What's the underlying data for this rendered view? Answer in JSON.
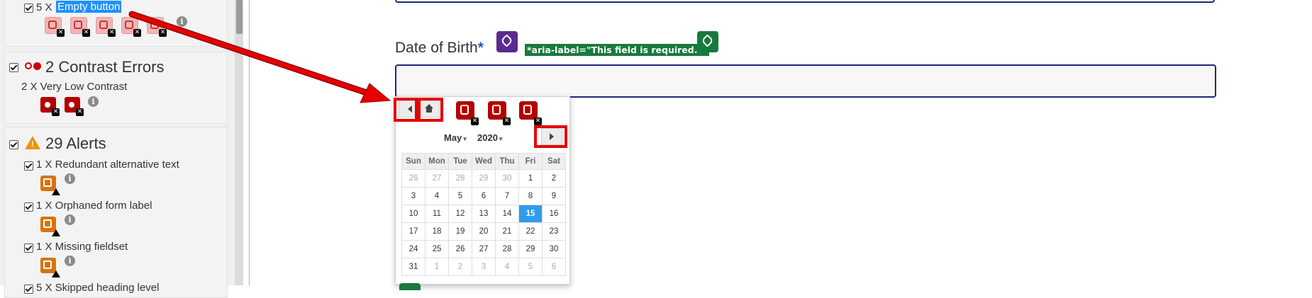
{
  "sidebar": {
    "empty_button": {
      "count": "5 X",
      "label": "Empty button",
      "icon": "empty-button-error-icon"
    },
    "contrast": {
      "title": "2 Contrast Errors",
      "sub": "2 X Very Low Contrast",
      "icon": "contrast-error-icon"
    },
    "alerts": {
      "title": "29 Alerts",
      "items": [
        {
          "label": "1 X Redundant alternative text",
          "icon": "redundant-alt-alert-icon"
        },
        {
          "label": "1 X Orphaned form label",
          "icon": "orphaned-label-alert-icon"
        },
        {
          "label": "1 X Missing fieldset",
          "icon": "missing-fieldset-alert-icon"
        },
        {
          "label": "5 X Skipped heading level",
          "icon": "skipped-heading-alert-icon"
        }
      ]
    }
  },
  "form": {
    "dob_label": "Date of Birth",
    "required_mark": "*",
    "aria_note": "*aria-label=\"This field is required.\"*",
    "dob_value": ""
  },
  "calendar": {
    "month": "May",
    "year": "2020",
    "weekdays": [
      "Sun",
      "Mon",
      "Tue",
      "Wed",
      "Thu",
      "Fri",
      "Sat"
    ],
    "weeks": [
      [
        "26",
        "27",
        "28",
        "29",
        "30",
        "1",
        "2"
      ],
      [
        "3",
        "4",
        "5",
        "6",
        "7",
        "8",
        "9"
      ],
      [
        "10",
        "11",
        "12",
        "13",
        "14",
        "15",
        "16"
      ],
      [
        "17",
        "18",
        "19",
        "20",
        "21",
        "22",
        "23"
      ],
      [
        "24",
        "25",
        "26",
        "27",
        "28",
        "29",
        "30"
      ],
      [
        "31",
        "1",
        "2",
        "3",
        "4",
        "5",
        "6"
      ]
    ],
    "selected_day": "15"
  },
  "colors": {
    "error_red": "#b30000",
    "highlight_box": "#e60000",
    "aria_green": "#187a3c",
    "selected_day": "#2f9bf0",
    "field_border": "#1e2a78"
  }
}
